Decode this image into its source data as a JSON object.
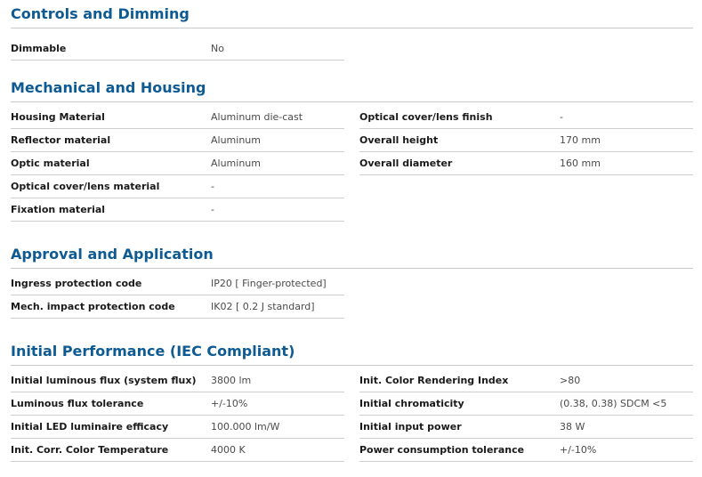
{
  "sections": [
    {
      "title": "Controls and Dimming",
      "left": [
        {
          "label": "Dimmable",
          "value": "No"
        }
      ],
      "right": []
    },
    {
      "title": "Mechanical and Housing",
      "left": [
        {
          "label": "Housing Material",
          "value": "Aluminum die-cast"
        },
        {
          "label": "Reflector material",
          "value": "Aluminum"
        },
        {
          "label": "Optic material",
          "value": "Aluminum"
        },
        {
          "label": "Optical cover/lens material",
          "value": "-"
        },
        {
          "label": "Fixation material",
          "value": "-"
        }
      ],
      "right": [
        {
          "label": "Optical cover/lens finish",
          "value": "-"
        },
        {
          "label": "Overall height",
          "value": "170 mm"
        },
        {
          "label": "Overall diameter",
          "value": "160 mm"
        }
      ]
    },
    {
      "title": "Approval and Application",
      "left": [
        {
          "label": "Ingress protection code",
          "value": "IP20  [ Finger-protected]"
        },
        {
          "label": "Mech. impact protection code",
          "value": "IK02  [ 0.2 J standard]"
        }
      ],
      "right": []
    },
    {
      "title": "Initial Performance (IEC Compliant)",
      "left": [
        {
          "label": "Initial luminous flux (system flux)",
          "value": "3800 lm"
        },
        {
          "label": "Luminous flux tolerance",
          "value": "+/-10%"
        },
        {
          "label": "Initial LED luminaire efficacy",
          "value": "100.000 lm/W"
        },
        {
          "label": "Init. Corr. Color Temperature",
          "value": "4000 K"
        }
      ],
      "right": [
        {
          "label": "Init. Color Rendering Index",
          "value": ">80"
        },
        {
          "label": "Initial chromaticity",
          "value": "(0.38, 0.38) SDCM <5"
        },
        {
          "label": "Initial input power",
          "value": "38 W"
        },
        {
          "label": "Power consumption tolerance",
          "value": "+/-10%"
        }
      ]
    }
  ]
}
